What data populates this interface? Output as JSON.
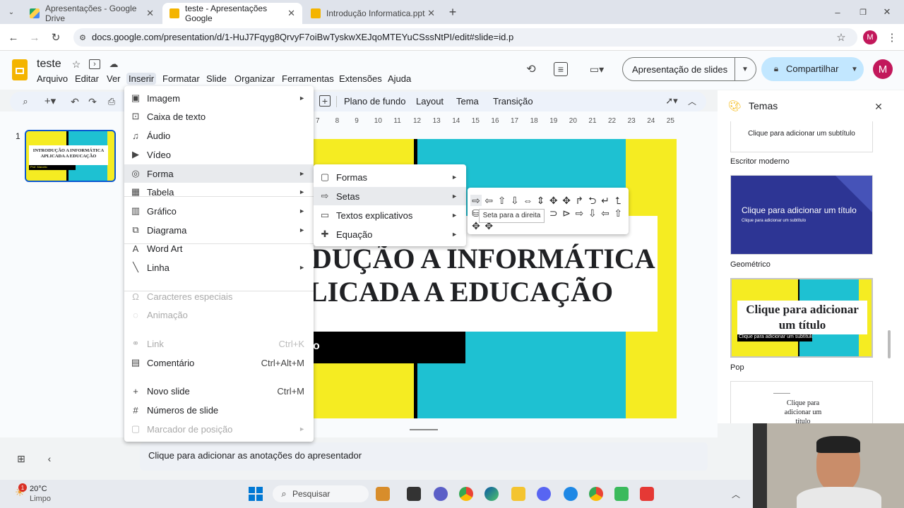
{
  "browser": {
    "tabs": [
      {
        "title": "Apresentações - Google Drive"
      },
      {
        "title": "teste - Apresentações Google"
      },
      {
        "title": "Introdução Informatica.pptx - A"
      }
    ],
    "url": "docs.google.com/presentation/d/1-HuJ7Fqyg8QrvyF7oiBwTyskwXEJqoMTEYuCSssNtPI/edit#slide=id.p",
    "profile": "M"
  },
  "doc": {
    "title": "teste",
    "menu": [
      "Arquivo",
      "Editar",
      "Ver",
      "Inserir",
      "Formatar",
      "Slide",
      "Organizar",
      "Ferramentas",
      "Extensões",
      "Ajuda"
    ],
    "slideshow_btn": "Apresentação de slides",
    "share_btn": "Compartilhar",
    "avatar": "M"
  },
  "toolbar": {
    "background": "Plano de fundo",
    "layout": "Layout",
    "theme": "Tema",
    "transition": "Transição"
  },
  "ruler": [
    "7",
    "8",
    "9",
    "10",
    "11",
    "12",
    "13",
    "14",
    "15",
    "16",
    "17",
    "18",
    "19",
    "20",
    "21",
    "22",
    "23",
    "24",
    "25"
  ],
  "filmstrip": {
    "num": "1",
    "thumb_title": "INTRODUÇÃO A INFORMÁTICA APLICADA A EDUCAÇÃO",
    "thumb_sub": "Prof. Marcelo"
  },
  "slide": {
    "line1": "DUÇÃO A INFORMÁTICA",
    "line2": "LICADA A EDUCAÇÃO",
    "black_text": "o"
  },
  "insert_menu": [
    {
      "label": "Imagem",
      "icon": "image-icon",
      "arrow": "►"
    },
    {
      "label": "Caixa de texto",
      "icon": "textbox-icon"
    },
    {
      "label": "Áudio",
      "icon": "audio-icon"
    },
    {
      "label": "Vídeo",
      "icon": "video-icon"
    },
    {
      "label": "Forma",
      "icon": "shape-icon",
      "arrow": "►"
    },
    {
      "label": "Tabela",
      "icon": "table-icon",
      "arrow": "►"
    },
    {
      "label": "Gráfico",
      "icon": "chart-icon",
      "arrow": "►"
    },
    {
      "label": "Diagrama",
      "icon": "diagram-icon",
      "arrow": "►"
    },
    {
      "label": "Word Art",
      "icon": "wordart-icon"
    },
    {
      "label": "Linha",
      "icon": "line-icon",
      "arrow": "►"
    },
    {
      "label": "Caracteres especiais",
      "icon": "omega-icon"
    },
    {
      "label": "Animação",
      "icon": "animation-icon"
    },
    {
      "label": "Link",
      "icon": "link-icon",
      "shortcut": "Ctrl+K"
    },
    {
      "label": "Comentário",
      "icon": "comment-icon",
      "shortcut": "Ctrl+Alt+M"
    },
    {
      "label": "Novo slide",
      "icon": "plus-icon",
      "shortcut": "Ctrl+M"
    },
    {
      "label": "Números de slide",
      "icon": "hash-icon"
    },
    {
      "label": "Marcador de posição",
      "icon": "placeholder-icon",
      "arrow": "►"
    }
  ],
  "shape_menu": [
    {
      "label": "Formas",
      "arrow": "►"
    },
    {
      "label": "Setas",
      "arrow": "►"
    },
    {
      "label": "Textos explicativos",
      "arrow": "►"
    },
    {
      "label": "Equação",
      "arrow": "►"
    }
  ],
  "tooltip": "Seta para a direita",
  "themes": {
    "header": "Temas",
    "top_card_sub": "Clique para adicionar um subtítulo",
    "labels": [
      "Escritor moderno",
      "Geométrico",
      "Pop"
    ],
    "geo_title": "Clique para adicionar um título",
    "geo_sub": "Clique para adicionar um subtítulo",
    "pop_title": "Clique para adicionar um título",
    "pop_sub": "Clique para adicionar um subtítulo",
    "last_title": "Clique para adicionar um título"
  },
  "notes": "Clique para adicionar as anotações do apresentador",
  "taskbar": {
    "temp": "20°C",
    "weather": "Limpo",
    "badge": "1",
    "search": "Pesquisar"
  },
  "colors": {
    "yellow": "#f5ec22",
    "cyan": "#1ec1d2",
    "navy": "#2d3594",
    "accent": "#0b57d0"
  }
}
